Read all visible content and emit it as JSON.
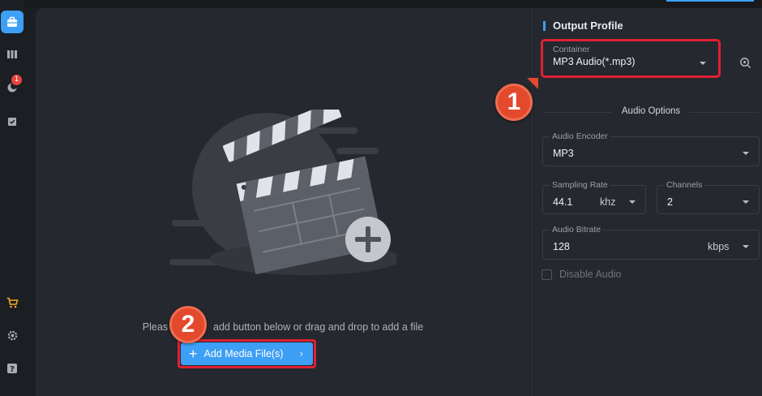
{
  "rail": {
    "items": [
      {
        "name": "toolbox-icon",
        "active": true
      },
      {
        "name": "library-icon",
        "active": false
      },
      {
        "name": "moon-clock-icon",
        "active": false,
        "badge": "1"
      },
      {
        "name": "checklist-icon",
        "active": false
      },
      {
        "name": "cart-icon",
        "active": false
      },
      {
        "name": "gear-icon",
        "active": false
      },
      {
        "name": "help-icon",
        "active": false
      }
    ]
  },
  "main": {
    "hint_text": "Please click add button below or drag and drop to add a file",
    "hint_visible_prefix": "Pleas",
    "hint_visible_suffix": "add button below or drag and drop to add a file",
    "add_button_label": "Add Media File(s)",
    "add_button_icon": "plus-icon",
    "add_button_chevron": "chevron-right-icon"
  },
  "panel": {
    "title": "Output Profile",
    "container": {
      "label": "Container",
      "value": "MP3 Audio(*.mp3)"
    },
    "settings_icon": "settings-icon",
    "audio_options_title": "Audio Options",
    "audio_encoder": {
      "label": "Audio Encoder",
      "value": "MP3"
    },
    "sampling_rate": {
      "label": "Sampling Rate",
      "value": "44.1",
      "unit": "khz"
    },
    "channels": {
      "label": "Channels",
      "value": "2"
    },
    "audio_bitrate": {
      "label": "Audio Bitrate",
      "value": "128",
      "unit": "kbps"
    },
    "disable_audio": {
      "label": "Disable Audio",
      "checked": false
    }
  },
  "callouts": {
    "first": "1",
    "second": "2"
  },
  "colors": {
    "accent": "#3d9ff5",
    "highlight": "#e02033",
    "callout": "#e2492d"
  }
}
